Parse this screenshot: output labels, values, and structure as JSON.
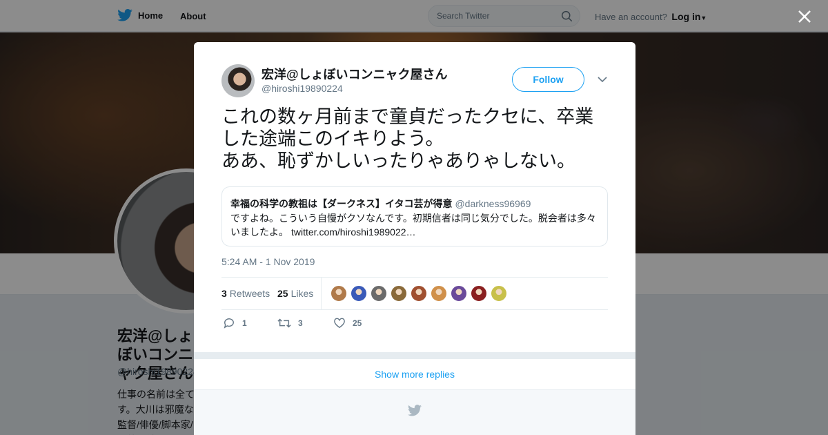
{
  "nav": {
    "home_label": "Home",
    "about_label": "About",
    "search_placeholder": "Search Twitter",
    "account_prompt": "Have an account?",
    "login_label": "Log in"
  },
  "profile": {
    "name": "宏洋@しょぼいコンニャク屋さん",
    "handle": "@hiroshi19890224",
    "bio": "仕事の名前は全てす。大川は邪魔な監督/俳優/脚本家/取締役社長/動画"
  },
  "tweet": {
    "author_name": "宏洋@しょぼいコンニャク屋さん",
    "author_handle": "@hiroshi19890224",
    "follow_label": "Follow",
    "text_lines": [
      "これの数ヶ月前まで童貞だったクセに、卒業",
      "した途端このイキりよう。",
      "ああ、恥ずかしいったりゃありゃしない。"
    ],
    "quote": {
      "name": "幸福の科学の教祖は【ダークネス】イタコ芸が得意",
      "handle": "@darkness96969",
      "text": "ですよね。こういう自慢がクソなんです。初期信者は同じ気分でした。脱会者は多々いましたよ。",
      "link": "twitter.com/hiroshi1989022…"
    },
    "timestamp": "5:24 AM - 1 Nov 2019",
    "retweets_count": "3",
    "retweets_label": "Retweets",
    "likes_count": "25",
    "likes_label": "Likes",
    "likers": [
      "#b07a4a",
      "#3a5ab8",
      "#6b6b6b",
      "#8a6a3a",
      "#a05030",
      "#d0904a",
      "#6a4a9a",
      "#8a2020",
      "#c8c04a"
    ],
    "reply_count": "1",
    "retweet_action_count": "3",
    "like_action_count": "25"
  },
  "show_more_label": "Show more replies",
  "colors": {
    "accent": "#1da1f2",
    "text": "#14171a",
    "secondary": "#657786"
  }
}
